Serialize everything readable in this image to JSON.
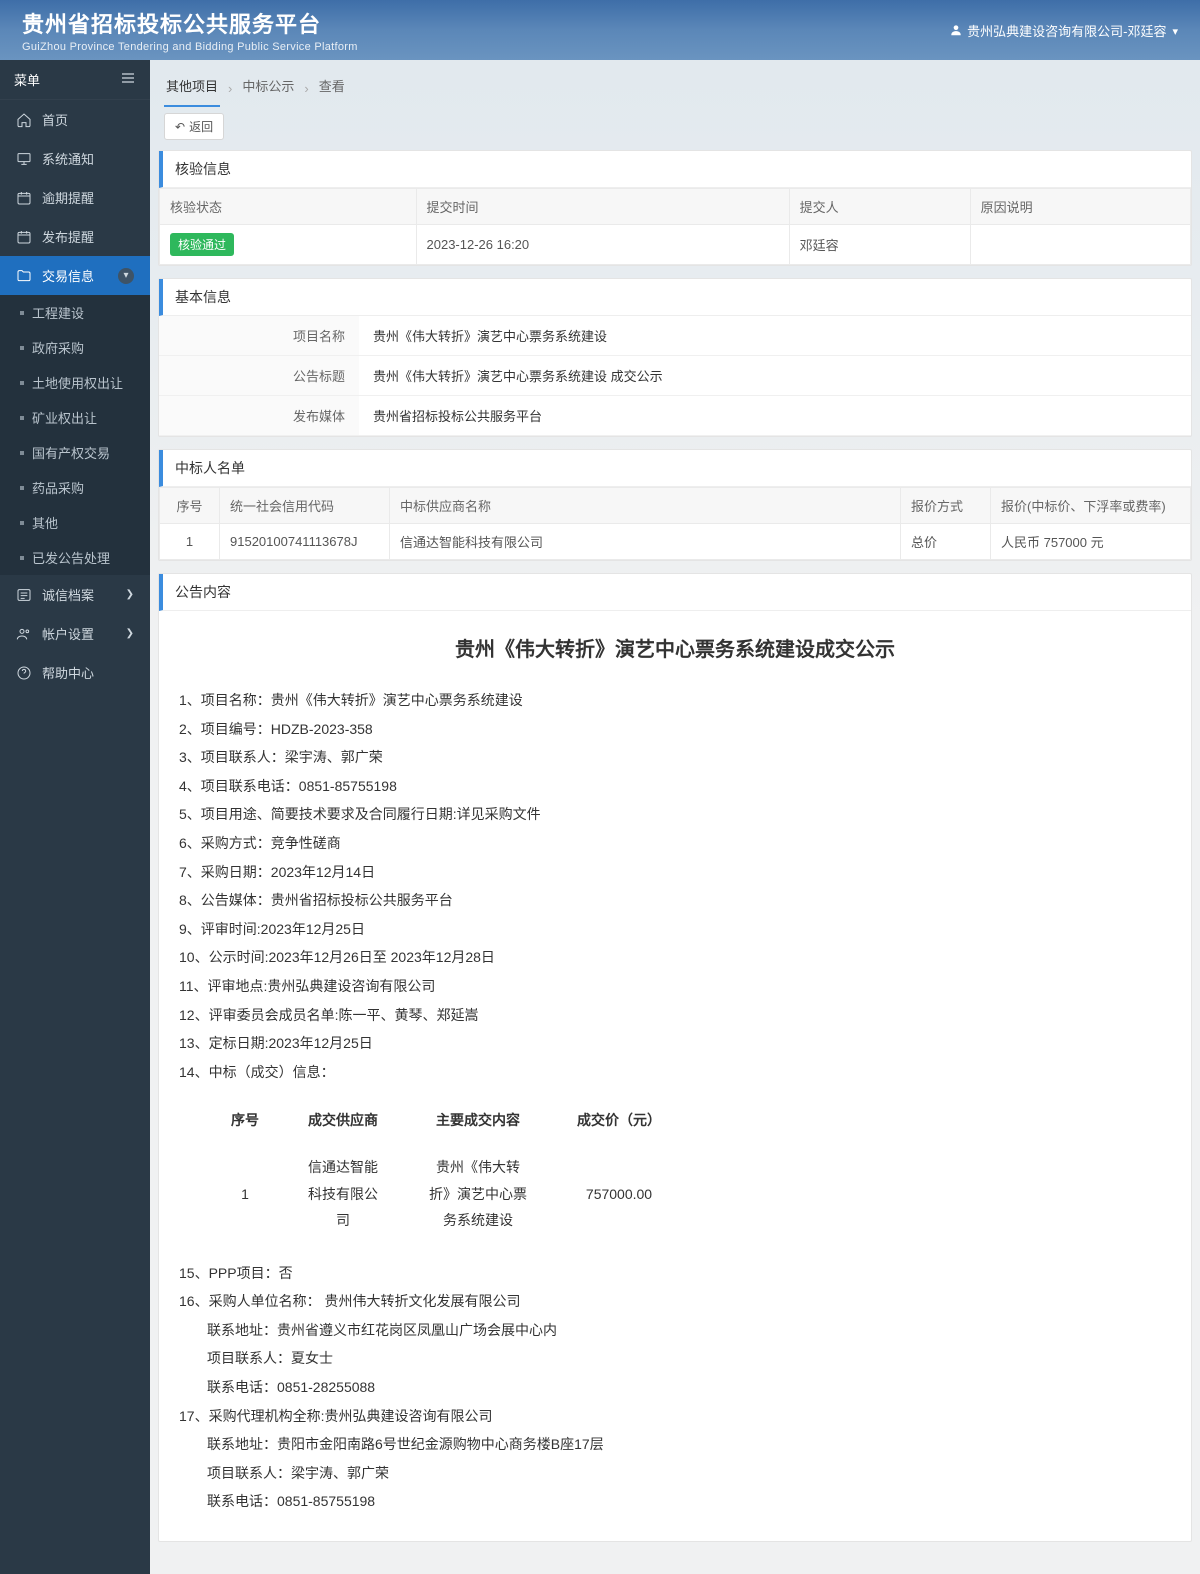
{
  "header": {
    "title": "贵州省招标投标公共服务平台",
    "subtitle": "GuiZhou Province Tendering and Bidding Public Service Platform",
    "user": "贵州弘典建设咨询有限公司-邓廷容"
  },
  "sidebar": {
    "menu_label": "菜单",
    "items": [
      {
        "label": "首页"
      },
      {
        "label": "系统通知"
      },
      {
        "label": "逾期提醒"
      },
      {
        "label": "发布提醒"
      },
      {
        "label": "交易信息",
        "active": true,
        "children": [
          {
            "label": "工程建设"
          },
          {
            "label": "政府采购"
          },
          {
            "label": "土地使用权出让"
          },
          {
            "label": "矿业权出让"
          },
          {
            "label": "国有产权交易"
          },
          {
            "label": "药品采购"
          },
          {
            "label": "其他"
          },
          {
            "label": "已发公告处理"
          }
        ]
      },
      {
        "label": "诚信档案"
      },
      {
        "label": "帐户设置"
      },
      {
        "label": "帮助中心"
      }
    ]
  },
  "breadcrumb": [
    "其他项目",
    "中标公示",
    "查看"
  ],
  "toolbar": {
    "back": "返回"
  },
  "panels": {
    "verify_title": "核验信息",
    "verify_headers": [
      "核验状态",
      "提交时间",
      "提交人",
      "原因说明"
    ],
    "verify_row": {
      "status_badge": "核验通过",
      "time": "2023-12-26 16:20",
      "submitter": "邓廷容",
      "reason": ""
    },
    "basic_title": "基本信息",
    "basic_rows": [
      {
        "k": "项目名称",
        "v": "贵州《伟大转折》演艺中心票务系统建设"
      },
      {
        "k": "公告标题",
        "v": "贵州《伟大转折》演艺中心票务系统建设 成交公示"
      },
      {
        "k": "发布媒体",
        "v": "贵州省招标投标公共服务平台"
      }
    ],
    "winners_title": "中标人名单",
    "winners_headers": [
      "序号",
      "统一社会信用代码",
      "中标供应商名称",
      "报价方式",
      "报价(中标价、下浮率或费率)"
    ],
    "winners_row": {
      "idx": "1",
      "code": "91520100741113678J",
      "name": "信通达智能科技有限公司",
      "mode": "总价",
      "price": "人民币 757000 元"
    },
    "content_title": "公告内容"
  },
  "notice": {
    "title": "贵州《伟大转折》演艺中心票务系统建设成交公示",
    "lines": [
      "1、项目名称：贵州《伟大转折》演艺中心票务系统建设",
      "2、项目编号：HDZB-2023-358",
      "3、项目联系人：梁宇涛、郭广荣",
      "4、项目联系电话：0851-85755198",
      "5、项目用途、简要技术要求及合同履行日期:详见采购文件",
      "6、采购方式：竞争性磋商",
      "7、采购日期：2023年12月14日",
      "8、公告媒体：贵州省招标投标公共服务平台",
      "9、评审时间:2023年12月25日",
      "10、公示时间:2023年12月26日至 2023年12月28日",
      "11、评审地点:贵州弘典建设咨询有限公司",
      "12、评审委员会成员名单:陈一平、黄琴、郑延嵩",
      "13、定标日期:2023年12月25日",
      "14、中标（成交）信息："
    ],
    "deal_headers": [
      "序号",
      "成交供应商",
      "主要成交内容",
      "成交价（元）"
    ],
    "deal_row": {
      "idx": "1",
      "supplier": "信通达智能科技有限公司",
      "content": "贵州《伟大转折》演艺中心票务系统建设",
      "price": "757000.00"
    },
    "lines2": [
      "15、PPP项目：否",
      "16、采购人单位名称：  贵州伟大转折文化发展有限公司"
    ],
    "lines2_indent": [
      "联系地址：贵州省遵义市红花岗区凤凰山广场会展中心内",
      "项目联系人：夏女士",
      "联系电话：0851-28255088"
    ],
    "lines3": [
      "17、采购代理机构全称:贵州弘典建设咨询有限公司"
    ],
    "lines3_indent": [
      "联系地址：贵阳市金阳南路6号世纪金源购物中心商务楼B座17层",
      "项目联系人：梁宇涛、郭广荣",
      "联系电话：0851-85755198"
    ]
  }
}
